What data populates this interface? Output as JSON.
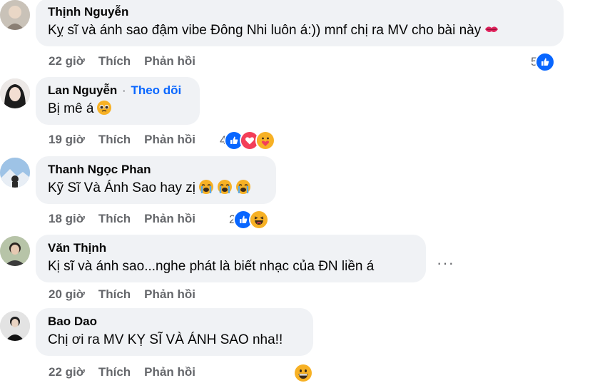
{
  "comments": [
    {
      "author": "Thịnh Nguyễn",
      "text": "Kỵ sĩ và ánh sao đậm vibe Đông Nhi luôn á:)) mnf chị ra MV cho bài này",
      "time": "22 giờ",
      "like": "Thích",
      "reply": "Phản hồi",
      "reaction_count": "5"
    },
    {
      "author": "Lan Nguyễn",
      "follow": "Theo dõi",
      "dot": "·",
      "text": "Bị mê á",
      "time": "19 giờ",
      "like": "Thích",
      "reply": "Phản hồi",
      "reaction_count": "4"
    },
    {
      "author": "Thanh Ngọc Phan",
      "text": "Kỹ Sĩ Và Ánh Sao hay zị",
      "time": "18 giờ",
      "like": "Thích",
      "reply": "Phản hồi",
      "reaction_count": "2"
    },
    {
      "author": "Văn Thịnh",
      "text": "Kị sĩ và ánh sao...nghe phát là biết nhạc của ĐN liền á",
      "time": "20 giờ",
      "like": "Thích",
      "reply": "Phản hồi"
    },
    {
      "author": "Bao Dao",
      "text": "Chị ơi ra MV KỴ SĨ VÀ ÁNH SAO nha!!",
      "time": "22 giờ",
      "like": "Thích",
      "reply": "Phản hồi"
    }
  ],
  "more_options": "···",
  "colors": {
    "bubble": "#f0f2f5",
    "meta": "#65676b",
    "like_blue": "#0866ff",
    "love_red": "#f33e58",
    "haha_yellow": "#f7b125"
  },
  "icons": [
    "like-icon",
    "love-icon",
    "care-icon",
    "haha-icon",
    "kiss-emoji",
    "pleading-emoji",
    "crying-emoji",
    "grin-emoji"
  ]
}
